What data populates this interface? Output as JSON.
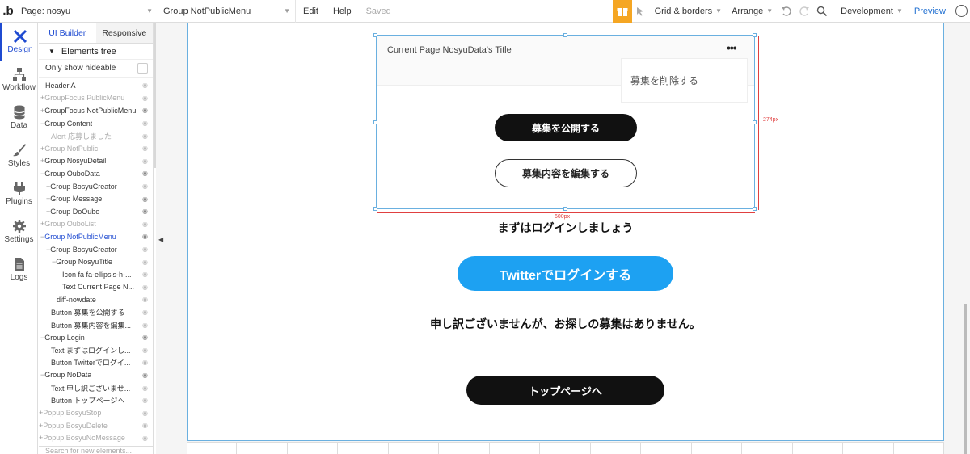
{
  "topbar": {
    "logo": ".b",
    "page_select": "Page: nosyu",
    "element_select": "Group NotPublicMenu",
    "edit": "Edit",
    "help": "Help",
    "saved": "Saved",
    "grid_borders": "Grid & borders",
    "arrange": "Arrange",
    "development": "Development",
    "preview": "Preview"
  },
  "leftnav": [
    {
      "label": "Design",
      "icon": "design-icon"
    },
    {
      "label": "Workflow",
      "icon": "workflow-icon"
    },
    {
      "label": "Data",
      "icon": "database-icon"
    },
    {
      "label": "Styles",
      "icon": "brush-icon"
    },
    {
      "label": "Plugins",
      "icon": "plug-icon"
    },
    {
      "label": "Settings",
      "icon": "gear-icon"
    },
    {
      "label": "Logs",
      "icon": "document-icon"
    }
  ],
  "panel": {
    "tabs": [
      "UI Builder",
      "Responsive"
    ],
    "tree_title": "Elements tree",
    "only_hideable": "Only show hideable",
    "search_placeholder": "Search for new elements..."
  },
  "tree": [
    {
      "label": "Header A",
      "indent": 0,
      "prefix": "",
      "state": "normal",
      "eye": false
    },
    {
      "label": "GroupFocus PublicMenu",
      "indent": 0,
      "prefix": "+",
      "state": "grey",
      "eye": false
    },
    {
      "label": "GroupFocus NotPublicMenu",
      "indent": 0,
      "prefix": "+",
      "state": "normal",
      "eye": true
    },
    {
      "label": "Group Content",
      "indent": 0,
      "prefix": "−",
      "state": "normal",
      "eye": false
    },
    {
      "label": "Alert 応募しました",
      "indent": 1,
      "prefix": "",
      "state": "grey",
      "eye": false
    },
    {
      "label": "Group NotPublic",
      "indent": 0,
      "prefix": "+",
      "state": "grey",
      "eye": false
    },
    {
      "label": "Group NosyuDetail",
      "indent": 0,
      "prefix": "+",
      "state": "normal",
      "eye": false
    },
    {
      "label": "Group OuboData",
      "indent": 0,
      "prefix": "−",
      "state": "normal",
      "eye": true
    },
    {
      "label": "Group BosyuCreator",
      "indent": 1,
      "prefix": "+",
      "state": "normal",
      "eye": false
    },
    {
      "label": "Group Message",
      "indent": 1,
      "prefix": "+",
      "state": "normal",
      "eye": true
    },
    {
      "label": "Group DoOubo",
      "indent": 1,
      "prefix": "+",
      "state": "normal",
      "eye": true
    },
    {
      "label": "Group OuboList",
      "indent": 0,
      "prefix": "+",
      "state": "grey",
      "eye": false
    },
    {
      "label": "Group NotPublicMenu",
      "indent": 0,
      "prefix": "−",
      "state": "sel",
      "eye": true
    },
    {
      "label": "Group BosyuCreator",
      "indent": 1,
      "prefix": "−",
      "state": "normal",
      "eye": false
    },
    {
      "label": "Group NosyuTitle",
      "indent": 2,
      "prefix": "−",
      "state": "normal",
      "eye": false
    },
    {
      "label": "Icon fa fa-ellipsis-h-...",
      "indent": 3,
      "prefix": "",
      "state": "normal",
      "eye": false
    },
    {
      "label": "Text Current Page N...",
      "indent": 3,
      "prefix": "",
      "state": "normal",
      "eye": false
    },
    {
      "label": "diff-nowdate",
      "indent": 2,
      "prefix": "",
      "state": "normal",
      "eye": false
    },
    {
      "label": "Button 募集を公開する",
      "indent": 1,
      "prefix": "",
      "state": "normal",
      "eye": false
    },
    {
      "label": "Button 募集内容を編集...",
      "indent": 1,
      "prefix": "",
      "state": "normal",
      "eye": false
    },
    {
      "label": "Group Login",
      "indent": 0,
      "prefix": "−",
      "state": "normal",
      "eye": true
    },
    {
      "label": "Text まずはログインし...",
      "indent": 1,
      "prefix": "",
      "state": "normal",
      "eye": false
    },
    {
      "label": "Button Twitterでログイ...",
      "indent": 1,
      "prefix": "",
      "state": "normal",
      "eye": false
    },
    {
      "label": "Group NoData",
      "indent": 0,
      "prefix": "−",
      "state": "normal",
      "eye": true
    },
    {
      "label": "Text 申し訳ございませ...",
      "indent": 1,
      "prefix": "",
      "state": "normal",
      "eye": false
    },
    {
      "label": "Button トップページへ",
      "indent": 1,
      "prefix": "",
      "state": "normal",
      "eye": false
    },
    {
      "label": "Popup BosyuStop",
      "indent": -1,
      "prefix": "+",
      "state": "grey",
      "eye": false
    },
    {
      "label": "Popup BosyuDelete",
      "indent": -1,
      "prefix": "+",
      "state": "grey",
      "eye": false
    },
    {
      "label": "Popup BosyuNoMessage",
      "indent": -1,
      "prefix": "+",
      "state": "grey",
      "eye": false
    }
  ],
  "canvas": {
    "group_title": "Current Page NosyuData's Title",
    "ellipsis": "•••",
    "dropdown_item": "募集を削除する",
    "publish_button": "募集を公開する",
    "edit_button": "募集内容を編集する",
    "width_label": "600px",
    "height_label": "274px",
    "login_text": "まずはログインしましょう",
    "twitter_button": "Twitterでログインする",
    "nodata_text": "申し訳ございませんが、お探しの募集はありません。",
    "top_button": "トップページへ"
  },
  "colors": {
    "accent": "#1f4bd1",
    "twitter": "#1da1f2",
    "selection": "#6ab0e0",
    "dimension": "#e04040",
    "gift": "#f5a623"
  }
}
